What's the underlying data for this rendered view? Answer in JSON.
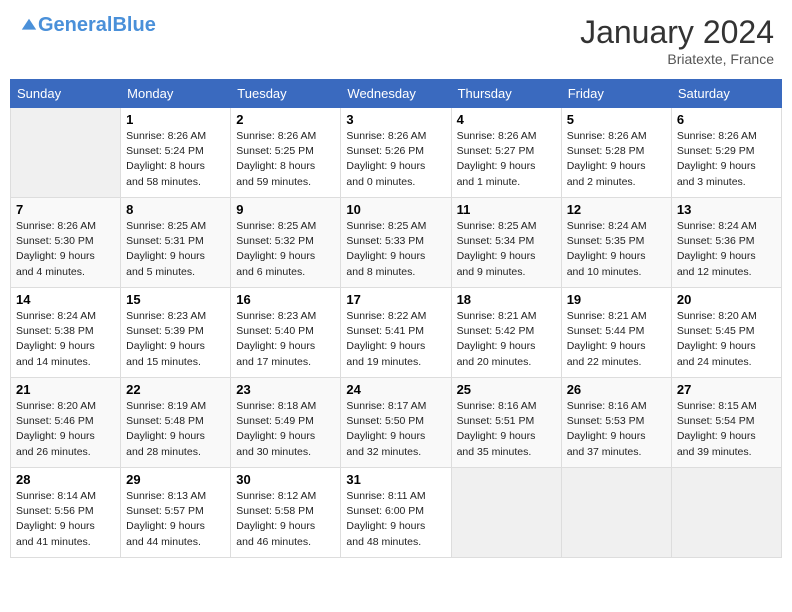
{
  "header": {
    "logo_general": "General",
    "logo_blue": "Blue",
    "month": "January 2024",
    "location": "Briatexte, France"
  },
  "days": [
    "Sunday",
    "Monday",
    "Tuesday",
    "Wednesday",
    "Thursday",
    "Friday",
    "Saturday"
  ],
  "weeks": [
    [
      {
        "day": "",
        "content": ""
      },
      {
        "day": "1",
        "content": "Sunrise: 8:26 AM\nSunset: 5:24 PM\nDaylight: 8 hours\nand 58 minutes."
      },
      {
        "day": "2",
        "content": "Sunrise: 8:26 AM\nSunset: 5:25 PM\nDaylight: 8 hours\nand 59 minutes."
      },
      {
        "day": "3",
        "content": "Sunrise: 8:26 AM\nSunset: 5:26 PM\nDaylight: 9 hours\nand 0 minutes."
      },
      {
        "day": "4",
        "content": "Sunrise: 8:26 AM\nSunset: 5:27 PM\nDaylight: 9 hours\nand 1 minute."
      },
      {
        "day": "5",
        "content": "Sunrise: 8:26 AM\nSunset: 5:28 PM\nDaylight: 9 hours\nand 2 minutes."
      },
      {
        "day": "6",
        "content": "Sunrise: 8:26 AM\nSunset: 5:29 PM\nDaylight: 9 hours\nand 3 minutes."
      }
    ],
    [
      {
        "day": "7",
        "content": "Sunrise: 8:26 AM\nSunset: 5:30 PM\nDaylight: 9 hours\nand 4 minutes."
      },
      {
        "day": "8",
        "content": "Sunrise: 8:25 AM\nSunset: 5:31 PM\nDaylight: 9 hours\nand 5 minutes."
      },
      {
        "day": "9",
        "content": "Sunrise: 8:25 AM\nSunset: 5:32 PM\nDaylight: 9 hours\nand 6 minutes."
      },
      {
        "day": "10",
        "content": "Sunrise: 8:25 AM\nSunset: 5:33 PM\nDaylight: 9 hours\nand 8 minutes."
      },
      {
        "day": "11",
        "content": "Sunrise: 8:25 AM\nSunset: 5:34 PM\nDaylight: 9 hours\nand 9 minutes."
      },
      {
        "day": "12",
        "content": "Sunrise: 8:24 AM\nSunset: 5:35 PM\nDaylight: 9 hours\nand 10 minutes."
      },
      {
        "day": "13",
        "content": "Sunrise: 8:24 AM\nSunset: 5:36 PM\nDaylight: 9 hours\nand 12 minutes."
      }
    ],
    [
      {
        "day": "14",
        "content": "Sunrise: 8:24 AM\nSunset: 5:38 PM\nDaylight: 9 hours\nand 14 minutes."
      },
      {
        "day": "15",
        "content": "Sunrise: 8:23 AM\nSunset: 5:39 PM\nDaylight: 9 hours\nand 15 minutes."
      },
      {
        "day": "16",
        "content": "Sunrise: 8:23 AM\nSunset: 5:40 PM\nDaylight: 9 hours\nand 17 minutes."
      },
      {
        "day": "17",
        "content": "Sunrise: 8:22 AM\nSunset: 5:41 PM\nDaylight: 9 hours\nand 19 minutes."
      },
      {
        "day": "18",
        "content": "Sunrise: 8:21 AM\nSunset: 5:42 PM\nDaylight: 9 hours\nand 20 minutes."
      },
      {
        "day": "19",
        "content": "Sunrise: 8:21 AM\nSunset: 5:44 PM\nDaylight: 9 hours\nand 22 minutes."
      },
      {
        "day": "20",
        "content": "Sunrise: 8:20 AM\nSunset: 5:45 PM\nDaylight: 9 hours\nand 24 minutes."
      }
    ],
    [
      {
        "day": "21",
        "content": "Sunrise: 8:20 AM\nSunset: 5:46 PM\nDaylight: 9 hours\nand 26 minutes."
      },
      {
        "day": "22",
        "content": "Sunrise: 8:19 AM\nSunset: 5:48 PM\nDaylight: 9 hours\nand 28 minutes."
      },
      {
        "day": "23",
        "content": "Sunrise: 8:18 AM\nSunset: 5:49 PM\nDaylight: 9 hours\nand 30 minutes."
      },
      {
        "day": "24",
        "content": "Sunrise: 8:17 AM\nSunset: 5:50 PM\nDaylight: 9 hours\nand 32 minutes."
      },
      {
        "day": "25",
        "content": "Sunrise: 8:16 AM\nSunset: 5:51 PM\nDaylight: 9 hours\nand 35 minutes."
      },
      {
        "day": "26",
        "content": "Sunrise: 8:16 AM\nSunset: 5:53 PM\nDaylight: 9 hours\nand 37 minutes."
      },
      {
        "day": "27",
        "content": "Sunrise: 8:15 AM\nSunset: 5:54 PM\nDaylight: 9 hours\nand 39 minutes."
      }
    ],
    [
      {
        "day": "28",
        "content": "Sunrise: 8:14 AM\nSunset: 5:56 PM\nDaylight: 9 hours\nand 41 minutes."
      },
      {
        "day": "29",
        "content": "Sunrise: 8:13 AM\nSunset: 5:57 PM\nDaylight: 9 hours\nand 44 minutes."
      },
      {
        "day": "30",
        "content": "Sunrise: 8:12 AM\nSunset: 5:58 PM\nDaylight: 9 hours\nand 46 minutes."
      },
      {
        "day": "31",
        "content": "Sunrise: 8:11 AM\nSunset: 6:00 PM\nDaylight: 9 hours\nand 48 minutes."
      },
      {
        "day": "",
        "content": ""
      },
      {
        "day": "",
        "content": ""
      },
      {
        "day": "",
        "content": ""
      }
    ]
  ]
}
